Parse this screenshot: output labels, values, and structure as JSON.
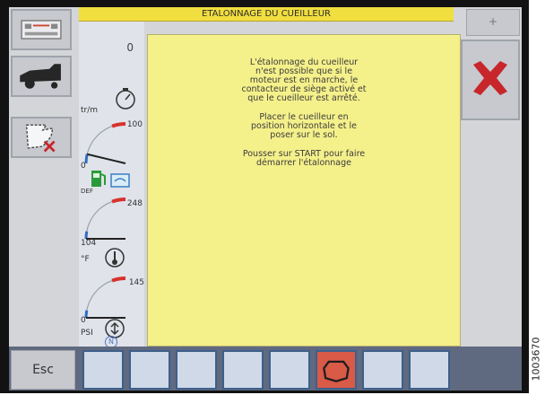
{
  "screen": {
    "title": "ETALONNAGE DU CUEILLEUR",
    "message": {
      "paragraph1": [
        "L'étalonnage du cueilleur",
        "n'est possible que si le",
        "moteur est en marche, le",
        "contacteur de siège activé et",
        "que le cueilleur est arrêté."
      ],
      "paragraph2": [
        "Placer le cueilleur en",
        "position horizontale et le",
        "poser sur le sol."
      ],
      "paragraph3": [
        "Pousser sur START pour faire",
        "démarrer l'étalonnage"
      ]
    }
  },
  "left_panel": {
    "icons": [
      "header-config-icon",
      "combine-harvester-icon",
      "field-map-icon"
    ]
  },
  "gauges": {
    "rpm": {
      "value": "0",
      "unit": "tr/m"
    },
    "fuel": {
      "max": "100",
      "min": "0",
      "level_fraction": 0.15,
      "def_label": "DEF"
    },
    "coolant": {
      "max": "248",
      "min": "104",
      "unit": "°F",
      "level_fraction": 0.0
    },
    "oil_pressure": {
      "max": "145",
      "min": "0",
      "unit": "PSI",
      "level_fraction": 0.0
    },
    "neutral_label": "N"
  },
  "right_panel": {
    "top_label": "+",
    "cancel_icon": "cancel-x-icon"
  },
  "bottom_bar": {
    "esc_label": "Esc",
    "slots": [
      "",
      "",
      "",
      "",
      "",
      "engage-icon",
      "",
      ""
    ],
    "active_slot": 5
  },
  "reference_number": "1003670",
  "colors": {
    "title_bar": "#f1de3f",
    "content_bg": "#f4f08a",
    "cancel_x": "#c7262b",
    "active_slot": "#d85a47",
    "gauge_red": "#d7322c",
    "gauge_blue": "#2f6cc0"
  }
}
